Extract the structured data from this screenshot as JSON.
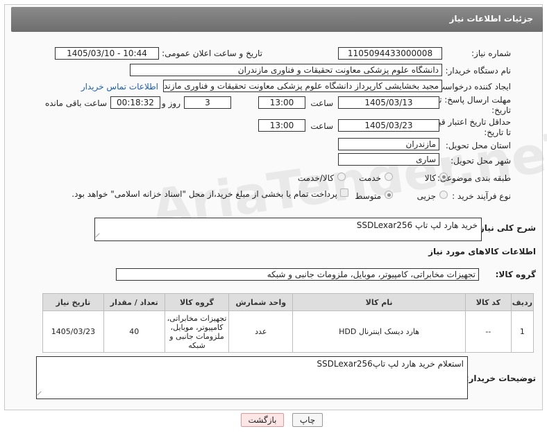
{
  "header": {
    "title": "جزئیات اطلاعات نیاز"
  },
  "form": {
    "need_number_label": "شماره نیاز:",
    "need_number": "1105094433000008",
    "announce_label": "تاریخ و ساعت اعلان عمومی:",
    "announce_value": "1405/03/10 - 10:44",
    "buyer_org_label": "نام دستگاه خریدار:",
    "buyer_org": "دانشگاه علوم پزشکی معاونت تحقیقات و فناوری مازندران",
    "creator_label": "ایجاد کننده درخواست:",
    "creator": "مجید بخشایشی کارپرداز دانشگاه علوم پزشکی معاونت تحقیقات و فناوری مازندران",
    "contact_link": "اطلاعات تماس خریدار",
    "deadline_label_1": "مهلت ارسال پاسخ: تا",
    "deadline_label_2": "تاریخ:",
    "deadline_date": "1405/03/13",
    "time_label": "ساعت",
    "deadline_time": "13:00",
    "days": "3",
    "days_label": "روز و",
    "remaining": "00:18:32",
    "remaining_label": "ساعت باقی مانده",
    "price_label_1": "حداقل تاریخ اعتبار قیمت:",
    "price_label_2": "تا تاریخ:",
    "price_date": "1405/03/23",
    "price_time": "13:00",
    "province_label": "استان محل تحویل:",
    "province": "مازندران",
    "city_label": "شهر محل تحویل:",
    "city": "ساری",
    "category_label": "طبقه بندی موضوعی:",
    "category_options": [
      "کالا",
      "خدمت",
      "کالا/خدمت"
    ],
    "process_label": "نوع فرآیند خرید :",
    "process_options": [
      "جزیی",
      "متوسط"
    ],
    "payment_note": "پرداخت تمام یا بخشی از مبلغ خرید،از محل \"اسناد خزانه اسلامی\" خواهد بود.",
    "summary_label": "شرح کلی نیاز:",
    "summary": "خرید هارد لپ تاپ SSDLexar256",
    "items_heading": "اطلاعات کالاهای مورد نیاز",
    "group_label": "گروه کالا:",
    "group_value": "تجهیزات مخابراتی، کامپیوتر، موبایل، ملزومات جانبی و شبکه"
  },
  "table": {
    "headers": [
      "ردیف",
      "کد کالا",
      "نام کالا",
      "واحد شمارش",
      "گروه کالا",
      "تعداد / مقدار",
      "تاریخ نیاز"
    ],
    "rows": [
      [
        "1",
        "--",
        "هارد دیسک اینترنال HDD",
        "عدد",
        "تجهیزات مخابراتی، کامپیوتر، موبایل، ملزومات جانبی و شبکه",
        "40",
        "1405/03/23"
      ]
    ]
  },
  "buyer_notes": {
    "label": "توضیحات خریدار:",
    "text": "استعلام خرید هارد لپ تاپSSDLexar256"
  },
  "buttons": {
    "print": "چاپ",
    "back": "بازگشت"
  },
  "watermark": "AriaTender.neT"
}
